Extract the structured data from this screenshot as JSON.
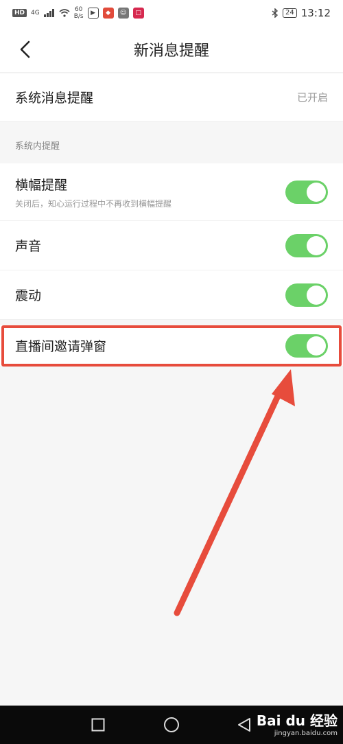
{
  "status_bar": {
    "hd": "HD",
    "net": "4G",
    "speed_top": "60",
    "speed_bottom": "B/s",
    "battery": "24",
    "time": "13:12"
  },
  "header": {
    "title": "新消息提醒"
  },
  "system_notice": {
    "label": "系统消息提醒",
    "value": "已开启"
  },
  "section": {
    "title": "系统内提醒"
  },
  "settings": [
    {
      "label": "横幅提醒",
      "sub": "关闭后，知心运行过程中不再收到横幅提醒",
      "enabled": true
    },
    {
      "label": "声音",
      "enabled": true
    },
    {
      "label": "震动",
      "enabled": true
    },
    {
      "label": "直播间邀请弹窗",
      "enabled": true
    }
  ],
  "colors": {
    "toggle_on": "#6bd168",
    "highlight": "#e74c3c"
  },
  "watermark": {
    "logo": "Bai du 经验",
    "url": "jingyan.baidu.com"
  }
}
